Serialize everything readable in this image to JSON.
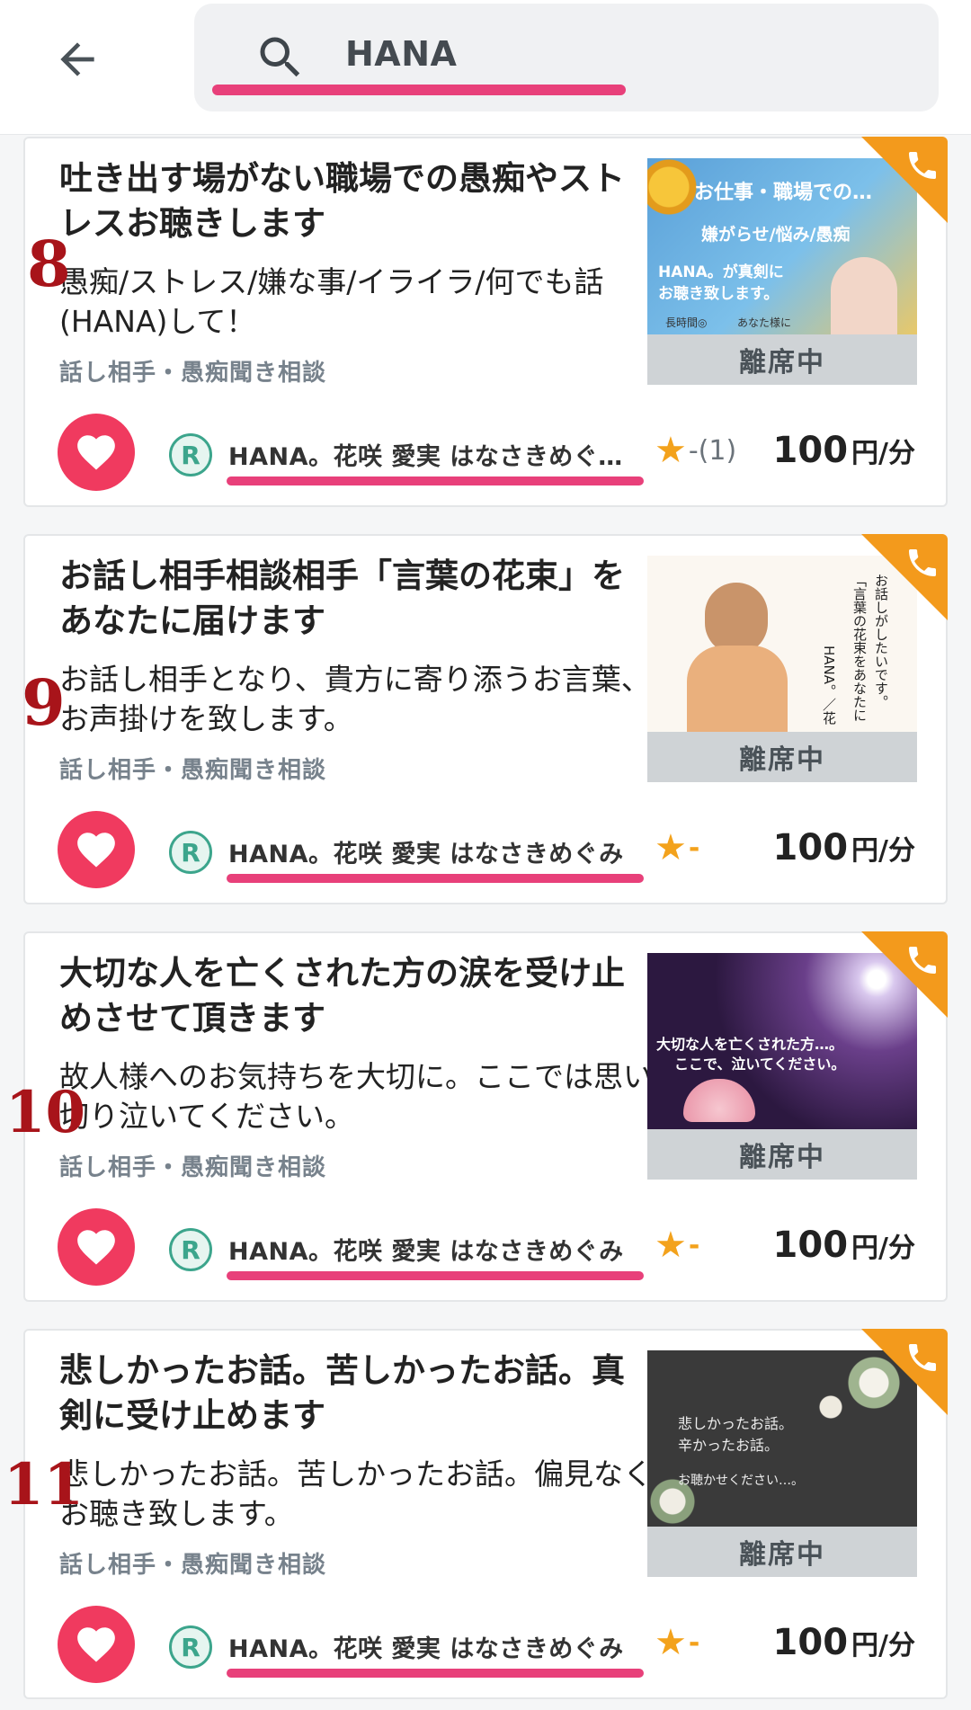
{
  "search": {
    "query": "HANA"
  },
  "cards": [
    {
      "title": "吐き出す場がない職場での愚痴やストレスお聴きします",
      "description": "愚痴/ストレス/嫌な事/イライラ/何でも話(HANA)して！",
      "category": "話し相手・愚痴聞き相談",
      "thumb_text": [
        "お仕事・職場での…",
        "嫌がらせ/悩み/愚痴",
        "HANA。が真剣に",
        "お聴き致します。",
        "長時間◎",
        "あなた様に"
      ],
      "status": "離席中",
      "seller": "HANA。花咲 愛実 はなさきめぐ…",
      "rating": "-(1)",
      "price": "100",
      "unit": "円/分",
      "annotation": "8"
    },
    {
      "title": "お話し相手相談相手「言葉の花束」をあなたに届けます",
      "description": "お話し相手となり、貴方に寄り添うお言葉、お声掛けを致します。",
      "category": "話し相手・愚痴聞き相談",
      "thumb_text": [
        "お話しがしたいです。",
        "「言葉の花束をあなたに",
        "HANA。／花"
      ],
      "status": "離席中",
      "seller": "HANA。花咲 愛実 はなさきめぐみ",
      "rating": "",
      "price": "100",
      "unit": "円/分",
      "annotation": "9"
    },
    {
      "title": "大切な人を亡くされた方の涙を受け止めさせて頂きます",
      "description": "故人様へのお気持ちを大切に。ここでは思い切り泣いてください。",
      "category": "話し相手・愚痴聞き相談",
      "thumb_text": [
        "大切な人を亡くされた方…。",
        "ここで、泣いてください。"
      ],
      "status": "離席中",
      "seller": "HANA。花咲 愛実 はなさきめぐみ",
      "rating": "",
      "price": "100",
      "unit": "円/分",
      "annotation": "10"
    },
    {
      "title": "悲しかったお話。苦しかったお話。真剣に受け止めます",
      "description": "悲しかったお話。苦しかったお話。偏見なくお聴き致します。",
      "category": "話し相手・愚痴聞き相談",
      "thumb_text": [
        "悲しかったお話。",
        "辛かったお話。",
        "お聴かせください…。"
      ],
      "status": "離席中",
      "seller": "HANA。花咲 愛実 はなさきめぐみ",
      "rating": "",
      "price": "100",
      "unit": "円/分",
      "annotation": "11"
    }
  ],
  "colors": {
    "accent_pink": "#e8407a",
    "heart_red": "#f03a5f",
    "badge_orange": "#f39a1c",
    "rank_green": "#3ca58c"
  },
  "icons": [
    "back-arrow-icon",
    "search-icon",
    "phone-icon",
    "heart-icon",
    "rank-r-icon",
    "star-icon"
  ]
}
